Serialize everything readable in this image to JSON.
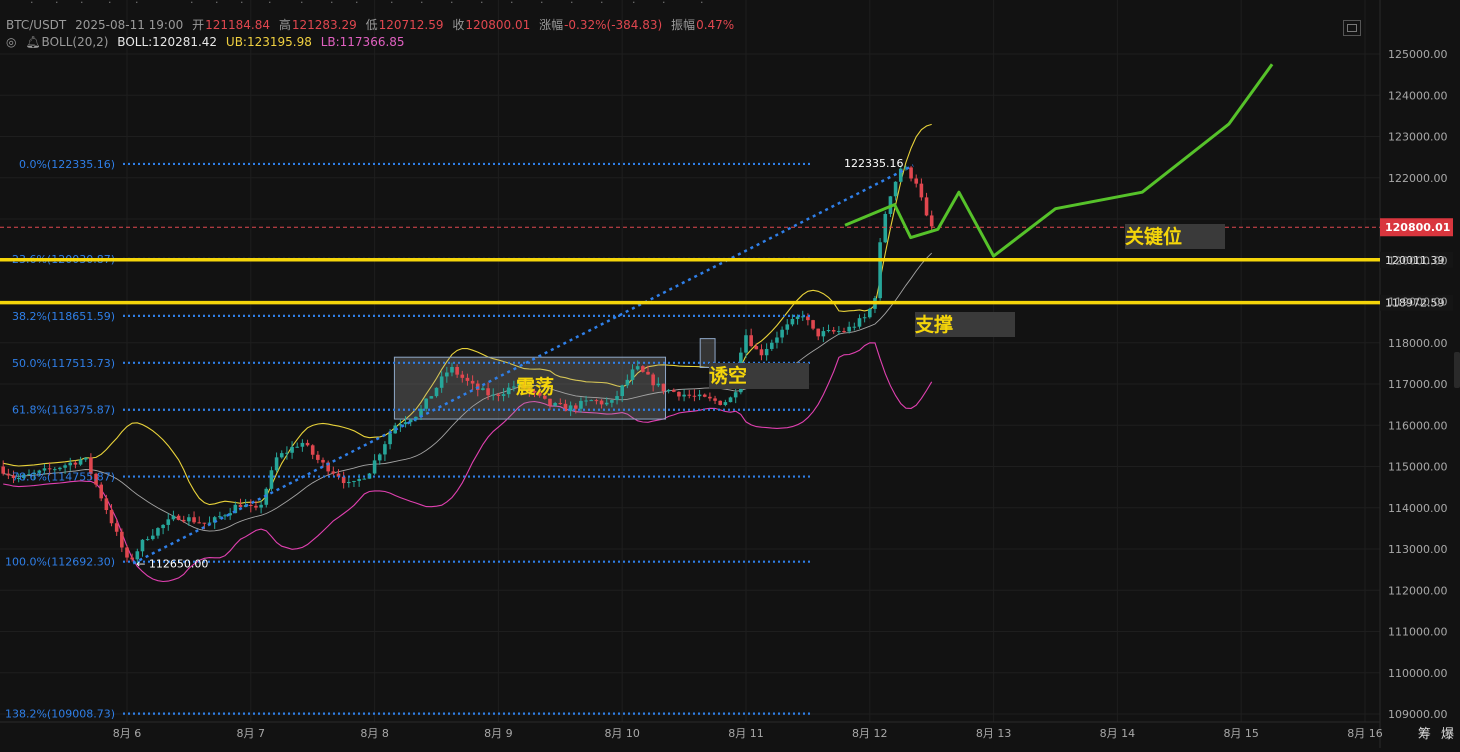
{
  "header": {
    "symbol": "BTC/USDT",
    "datetime": "2025-08-11 19:00",
    "open_label": "开",
    "open": "121184.84",
    "high_label": "高",
    "high": "121283.29",
    "low_label": "低",
    "low": "120712.59",
    "close_label": "收",
    "close": "120800.01",
    "change_label": "涨幅",
    "change": "-0.32%(-384.83)",
    "amp_label": "振幅",
    "amp": "0.47%",
    "boll_name": "BOLL(20,2)",
    "boll": "BOLL:120281.42",
    "ub": "UB:123195.98",
    "lb": "LB:117366.85"
  },
  "footer": {
    "left": "筹",
    "right": "爆"
  },
  "chart_data": {
    "type": "candlestick",
    "symbol": "BTC/USDT",
    "ylim": [
      108700,
      125600
    ],
    "y_ticks": [
      125000,
      124000,
      123000,
      122000,
      121000,
      120000,
      119000,
      118000,
      117000,
      116000,
      115000,
      114000,
      113000,
      112000,
      111000,
      110000,
      109000
    ],
    "y_tick_labels": [
      "125000.00",
      "124000.00",
      "123000.00",
      "122000.00",
      "121000.00",
      "120000.00",
      "119000.00",
      "118000.00",
      "117000.00",
      "116000.00",
      "115000.00",
      "114000.00",
      "113000.00",
      "112000.00",
      "111000.00",
      "110000.00",
      "109000.00"
    ],
    "x_ticks": [
      "8月 6",
      "8月 7",
      "8月 8",
      "8月 9",
      "8月 10",
      "8月 11",
      "8月 12",
      "8月 13",
      "8月 14",
      "8月 15",
      "8月 16"
    ],
    "current_price": 120800.01,
    "current_price_label": "120800.01",
    "fib_levels": [
      {
        "label": "0.0%(122335.16)",
        "price": 122335.16
      },
      {
        "label": "23.6%(120030.87)",
        "price": 120030.87
      },
      {
        "label": "38.2%(118651.59)",
        "price": 118651.59
      },
      {
        "label": "50.0%(117513.73)",
        "price": 117513.73
      },
      {
        "label": "61.8%(116375.87)",
        "price": 116375.87
      },
      {
        "label": "78.6%(114755.87)",
        "price": 114755.87
      },
      {
        "label": "100.0%(112692.30)",
        "price": 112692.3
      },
      {
        "label": "138.2%(109008.73)",
        "price": 109008.73
      }
    ],
    "horizontal_lines": [
      {
        "price": 120011.39,
        "label": "120011.39",
        "color": "#f5d50a"
      },
      {
        "price": 118972.59,
        "label": "118972.59",
        "color": "#f5d50a"
      }
    ],
    "extremes": {
      "high_label": "122335.16",
      "low_label": "112650.00"
    },
    "annotations": [
      {
        "text": "关键位"
      },
      {
        "text": "支撑"
      },
      {
        "text": "震荡"
      },
      {
        "text": "诱空"
      }
    ],
    "forecast_path": [
      {
        "day": 5.8,
        "price": 120850
      },
      {
        "day": 6.2,
        "price": 121350
      },
      {
        "day": 6.33,
        "price": 120550
      },
      {
        "day": 6.55,
        "price": 120750
      },
      {
        "day": 6.72,
        "price": 121650
      },
      {
        "day": 7.0,
        "price": 120100
      },
      {
        "day": 7.5,
        "price": 121250
      },
      {
        "day": 8.2,
        "price": 121650
      },
      {
        "day": 8.9,
        "price": 123300
      },
      {
        "day": 9.25,
        "price": 124750
      }
    ],
    "colors": {
      "up": "#26a69a",
      "down": "#e0474f",
      "fib": "#2f7fe8",
      "ub": "#e8d23a",
      "lb": "#e040b0",
      "mid": "#c8c8c8",
      "forecast": "#56c22a",
      "key": "#f5d50a"
    }
  }
}
